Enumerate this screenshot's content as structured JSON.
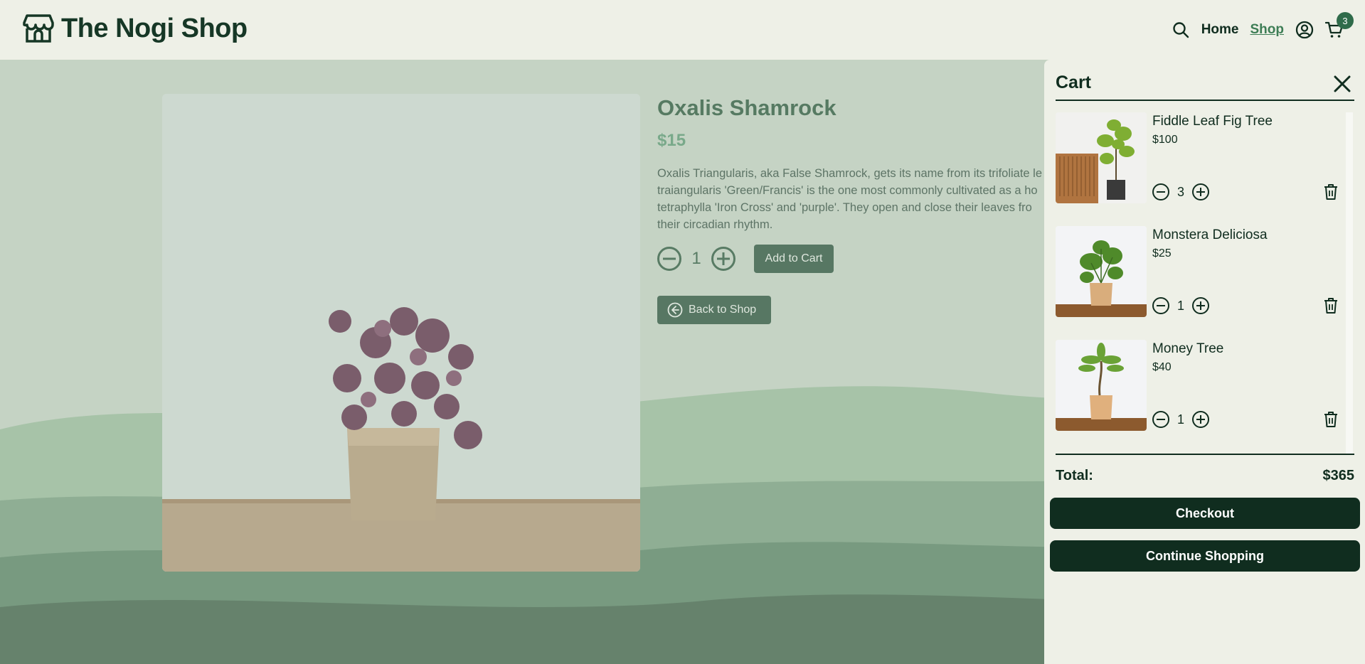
{
  "header": {
    "logo_icon": "storefront-icon",
    "title": "The Nogi Shop",
    "nav": {
      "search_icon": "search-icon",
      "home": "Home",
      "shop": "Shop",
      "account_icon": "user-icon",
      "cart_icon": "cart-icon",
      "cart_count": "3"
    }
  },
  "product": {
    "title": "Oxalis Shamrock",
    "price": "$15",
    "description": "Oxalis Triangularis, aka False Shamrock, gets its name from its trifoliate le\ntraiangularis 'Green/Francis' is the one most commonly cultivated as a ho\ntetraphylla 'Iron Cross' and 'purple'. They open and close their leaves fro\ntheir circadian rhythm.",
    "quantity": "1",
    "decrement": "−",
    "increment": "+",
    "add_to_cart": "Add to Cart",
    "back_to_shop": "Back to Shop"
  },
  "cart": {
    "title": "Cart",
    "items": [
      {
        "name": "Fiddle Leaf Fig Tree",
        "price": "$100",
        "quantity": "3"
      },
      {
        "name": "Monstera Deliciosa",
        "price": "$25",
        "quantity": "1"
      },
      {
        "name": "Money Tree",
        "price": "$40",
        "quantity": "1"
      }
    ],
    "total_label": "Total:",
    "total_value": "$365",
    "checkout": "Checkout",
    "continue_shopping": "Continue Shopping",
    "decrement": "−",
    "increment": "+"
  },
  "colors": {
    "brand_dark": "#102d1f",
    "brand_green": "#3d7d55",
    "page_bg": "#eef0e7",
    "overlay_bg": "#c5d3c4",
    "muted_button": "#577763"
  }
}
